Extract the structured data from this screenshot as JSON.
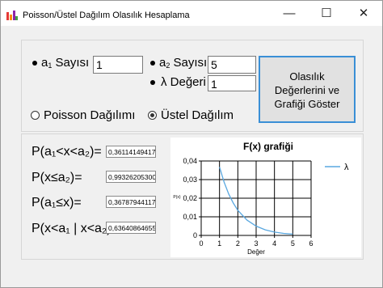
{
  "window": {
    "title": "Poisson/Üstel Dağılım Olasılık Hesaplama",
    "minimize_glyph": "—",
    "maximize_glyph": "☐",
    "close_glyph": "✕"
  },
  "inputs": {
    "a1_label": "a",
    "a1_sub": "1",
    "a1_suffix": " Sayısı",
    "a1_value": "1",
    "a2_label": "a",
    "a2_sub": "2",
    "a2_suffix": " Sayısı",
    "a2_value": "5",
    "lambda_label": "λ Değeri",
    "lambda_value": "1"
  },
  "calc_button": {
    "line1": "Olasılık",
    "line2": "Değerlerini   ve",
    "line3": "Grafiği Göster"
  },
  "distribution": {
    "poisson_label": "Poisson Dağılımı",
    "exponential_label": "Üstel Dağılım",
    "selected": "exponential"
  },
  "results": [
    {
      "label": "P(a₁<x<a₂)=",
      "value": "0,36114149417"
    },
    {
      "label": "P(x≤a₂)=",
      "value": "0,99326205300"
    },
    {
      "label": "P(a₁≤x)=",
      "value": "0,36787944117"
    },
    {
      "label": "P(x<a₁ | x<a₂)=",
      "value": "0,63640864655"
    }
  ],
  "chart_data": {
    "type": "line",
    "title": "F(x) grafiği",
    "xlabel": "Değer",
    "ylabel": "P(x)",
    "xlim": [
      0,
      6
    ],
    "ylim": [
      0,
      0.04
    ],
    "xticks": [
      "0",
      "1",
      "2",
      "3",
      "4",
      "5",
      "6"
    ],
    "yticks": [
      "0",
      "0,01",
      "0,02",
      "0,03",
      "0,04"
    ],
    "grid": true,
    "legend_position": "right",
    "series": [
      {
        "name": "λ",
        "color": "#5aa8e0",
        "x": [
          1,
          1.25,
          1.5,
          1.75,
          2,
          2.5,
          3,
          3.5,
          4,
          4.5,
          5
        ],
        "y": [
          0.0368,
          0.0287,
          0.0223,
          0.0174,
          0.0135,
          0.0082,
          0.005,
          0.003,
          0.0018,
          0.0011,
          0.0007
        ]
      }
    ]
  }
}
